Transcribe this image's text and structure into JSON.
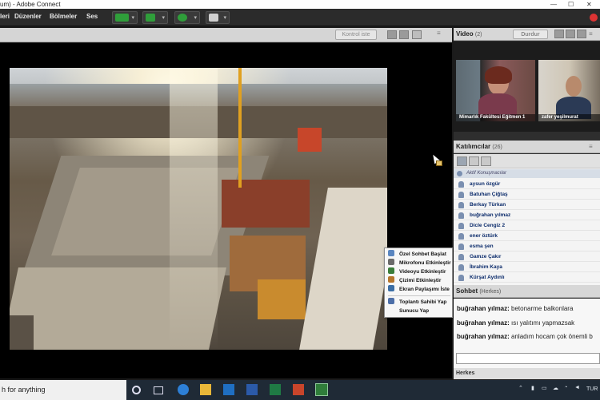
{
  "window": {
    "title_fragment": "um) - Adobe Connect"
  },
  "menu": {
    "items": [
      "leri",
      "Düzenler",
      "Bölmeler",
      "Ses"
    ]
  },
  "share_pod": {
    "control_button": "Kontrol iste"
  },
  "context_menu": {
    "items": [
      "Özel Sohbet Başlat",
      "Mikrofonu Etkinleştir",
      "Videoyu Etkinleştir",
      "Çizimi Etkinleştir",
      "Ekran Paylaşımı İste",
      "Toplantı Sahibi Yap",
      "Sunucu Yap"
    ]
  },
  "video_pod": {
    "title": "Video",
    "count": "(2)",
    "stop_button": "Durdur",
    "feeds": [
      {
        "label": "Mimarlık Fakültesi Eğitmen 1"
      },
      {
        "label": "zafer yeşilmurat"
      }
    ]
  },
  "attendees_pod": {
    "title": "Katılımcılar",
    "count": "(26)",
    "section": "Aktif Konuşmacılar",
    "names": [
      "aysun özgür",
      "Batuhan Çiğtaş",
      "Berkay Türkan",
      "buğrahan yılmaz",
      "Dicle Cengiz 2",
      "ener öztürk",
      "esma şen",
      "Gamze Çakır",
      "İbrahim Kaya",
      "Kürşat Aydınlı"
    ]
  },
  "chat_pod": {
    "title": "Sohbet",
    "scope": "(Herkes)",
    "messages": [
      {
        "sender": "buğrahan yılmaz:",
        "text": "betonarme balkonlara"
      },
      {
        "sender": "buğrahan yılmaz:",
        "text": "ısı yalıtımı yapmazsak"
      },
      {
        "sender": "buğrahan yılmaz:",
        "text": "anladım hocam çok önemli b"
      }
    ],
    "tab": "Herkes"
  },
  "taskbar": {
    "search_text": "h for anything",
    "tray": {
      "lang": "TUR"
    }
  }
}
